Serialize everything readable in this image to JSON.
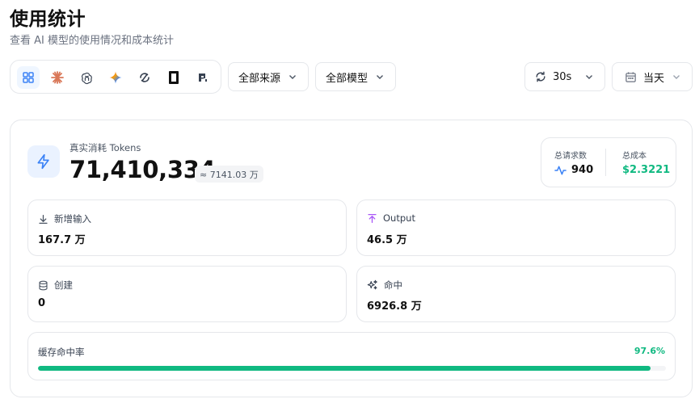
{
  "page": {
    "title": "使用统计",
    "subtitle": "查看 AI 模型的使用情况和成本统计"
  },
  "toolbar": {
    "providers": [
      {
        "name": "all-providers-icon",
        "active": true
      },
      {
        "name": "claude-icon",
        "active": false
      },
      {
        "name": "openai-icon",
        "active": false
      },
      {
        "name": "gemini-icon",
        "active": false
      },
      {
        "name": "refresh-provider-icon",
        "active": false
      },
      {
        "name": "black-square-icon",
        "active": false
      },
      {
        "name": "p-logo-icon",
        "active": false
      }
    ],
    "source_filter": "全部来源",
    "model_filter": "全部模型",
    "refresh_interval": "30s",
    "date_range": "当天"
  },
  "summary": {
    "tokens_label": "真实消耗 Tokens",
    "tokens_value": "71,410,334",
    "tokens_approx": "≈ 7141.03 万",
    "requests_label": "总请求数",
    "requests_value": "940",
    "cost_label": "总成本",
    "cost_value": "$2.3221"
  },
  "metrics": {
    "new_input": {
      "label": "新增输入",
      "value": "167.7 万"
    },
    "output": {
      "label": "Output",
      "value": "46.5 万"
    },
    "create": {
      "label": "创建",
      "value": "0"
    },
    "hit": {
      "label": "命中",
      "value": "6926.8 万"
    }
  },
  "cache": {
    "label": "缓存命中率",
    "percent_text": "97.6%",
    "percent": 97.6
  },
  "colors": {
    "accent": "#3b82f6",
    "success": "#10b981",
    "output_icon": "#a855f7",
    "border": "#e5e7eb"
  }
}
